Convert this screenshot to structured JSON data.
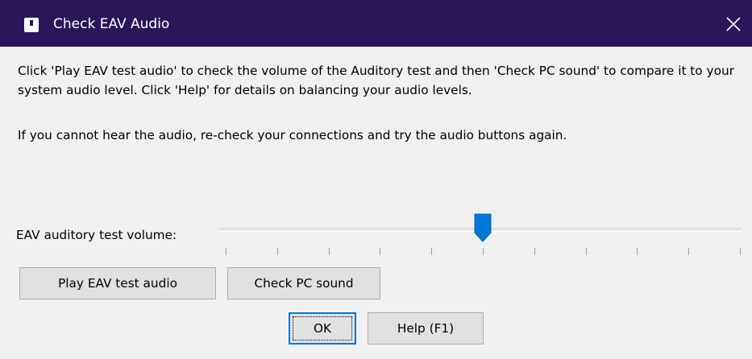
{
  "window": {
    "title": "Check EAV Audio",
    "title_bar_color": "#2b165b",
    "title_icon": "app-icon",
    "close_icon": "close-icon"
  },
  "instructions": {
    "paragraph1": "Click 'Play EAV test audio' to check the volume of the Auditory test and then 'Check PC sound' to compare it to your system audio level. Click 'Help' for details on balancing your audio levels.",
    "paragraph2": "If you cannot hear the audio, re-check your connections and try the audio buttons again."
  },
  "volume": {
    "label": "EAV auditory test volume:",
    "value_fraction": 0.5,
    "tick_count": 11,
    "thumb_color": "#0078d7"
  },
  "buttons": {
    "play_label": "Play EAV test audio",
    "check_label": "Check PC sound",
    "ok_label": "OK",
    "help_label": "Help (F1)"
  }
}
